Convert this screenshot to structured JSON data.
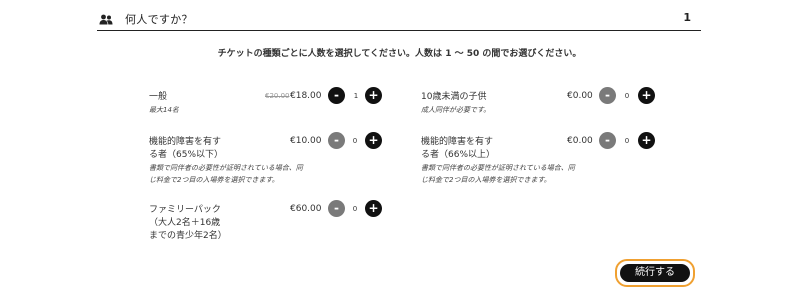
{
  "header": {
    "title": "何人ですか？",
    "count": "1"
  },
  "instruction": "チケットの種類ごとに人数を選択してください。人数は 1 〜 50 の間でお選びください。",
  "tickets": [
    {
      "name": "一般",
      "note": "最大14名",
      "old_price": "€20.00",
      "price": "€18.00",
      "quantity": "1",
      "minus": "-",
      "plus": "+"
    },
    {
      "name": "10歳未満の子供",
      "note": "成人同伴が必要です。",
      "price": "€0.00",
      "quantity": "0",
      "minus": "-",
      "plus": "+"
    },
    {
      "name": "機能的障害を有す\nる者（65%以下）",
      "note": "書類で同伴者の必要性が証明されている場合、同\nじ料金で2つ目の入場券を選択できます。",
      "price": "€10.00",
      "quantity": "0",
      "minus": "-",
      "plus": "+"
    },
    {
      "name": "機能的障害を有す\nる者（66%以上）",
      "note": "書類で同伴者の必要性が証明されている場合、同\nじ料金で2つ目の入場券を選択できます。",
      "price": "€0.00",
      "quantity": "0",
      "minus": "-",
      "plus": "+"
    },
    {
      "name": "ファミリーパック\n（大人2名＋16歳\nまでの青少年2名）",
      "price": "€60.00",
      "quantity": "0",
      "minus": "-",
      "plus": "+"
    }
  ],
  "continue_label": "続行する",
  "colors": {
    "accent_outline": "#f0a030",
    "button_dark": "#111111",
    "button_disabled": "#7a7a7a"
  }
}
